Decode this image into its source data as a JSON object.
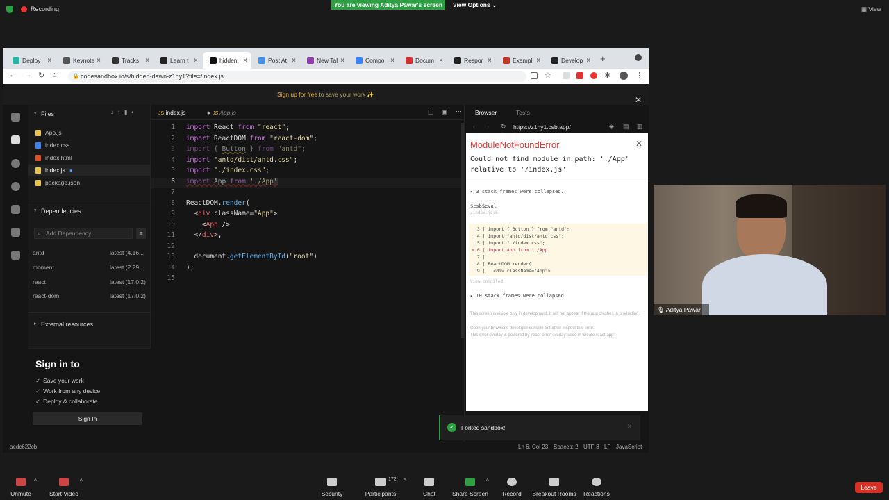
{
  "zoom_top": {
    "recording": "Recording",
    "viewing_banner": "You are viewing Aditya Pawar's screen",
    "view_options": "View Options",
    "view_right": "View"
  },
  "browser": {
    "tabs": [
      {
        "label": "Deploy",
        "color": "#2bb3a3"
      },
      {
        "label": "Keynote",
        "color": "#555555"
      },
      {
        "label": "Tracks",
        "color": "#333333"
      },
      {
        "label": "Learn t",
        "color": "#222222"
      },
      {
        "label": "hidden",
        "color": "#111111"
      },
      {
        "label": "Post At",
        "color": "#4a90e2"
      },
      {
        "label": "New Tal",
        "color": "#8e44ad"
      },
      {
        "label": "Compo",
        "color": "#3b82f6"
      },
      {
        "label": "Docum",
        "color": "#d32f2f"
      },
      {
        "label": "Respor",
        "color": "#222222"
      },
      {
        "label": "Exampl",
        "color": "#c0392b"
      },
      {
        "label": "Develop",
        "color": "#222222"
      }
    ],
    "url": "codesandbox.io/s/hidden-dawn-z1hy1?file=/index.js",
    "signup_link": "Sign up for free",
    "signup_rest": " to save your work ✨"
  },
  "sidebar": {
    "files_header": "Files",
    "files": [
      {
        "name": "App.js",
        "color": "#e8c547"
      },
      {
        "name": "index.css",
        "color": "#3b82f6"
      },
      {
        "name": "index.html",
        "color": "#e44d26"
      },
      {
        "name": "index.js",
        "color": "#e8c547"
      },
      {
        "name": "package.json",
        "color": "#e8c547"
      }
    ],
    "deps_header": "Dependencies",
    "add_dep_placeholder": "Add Dependency",
    "deps": [
      {
        "name": "antd",
        "version": "latest (4.16..."
      },
      {
        "name": "moment",
        "version": "latest (2.29..."
      },
      {
        "name": "react",
        "version": "latest (17.0.2)"
      },
      {
        "name": "react-dom",
        "version": "latest (17.0.2)"
      }
    ],
    "external_header": "External resources",
    "signin_title": "Sign in to",
    "signin_items": [
      "Save your work",
      "Work from any device",
      "Deploy & collaborate"
    ],
    "signin_button": "Sign In"
  },
  "editor": {
    "tab_active": "index.js",
    "tab_other": "App.js",
    "lines": [
      {
        "n": "1"
      },
      {
        "n": "2"
      },
      {
        "n": "3"
      },
      {
        "n": "4"
      },
      {
        "n": "5"
      },
      {
        "n": "6"
      },
      {
        "n": "7"
      },
      {
        "n": "8"
      },
      {
        "n": "9"
      },
      {
        "n": "10"
      },
      {
        "n": "11"
      },
      {
        "n": "12"
      },
      {
        "n": "13"
      },
      {
        "n": "14"
      },
      {
        "n": "15"
      }
    ]
  },
  "preview": {
    "tab_browser": "Browser",
    "tab_tests": "Tests",
    "url": "https://z1hy1.csb.app/",
    "error_title": "ModuleNotFoundError",
    "error_message": "Could not find module in path: './App' relative to '/index.js'",
    "collapsed_1": "▸ 3 stack frames were collapsed.",
    "eval_label": "$csb$eval",
    "eval_path": "/index.js:6",
    "snippet": [
      "  3 | import { Button } from \"antd\";",
      "  4 | import \"antd/dist/antd.css\";",
      "  5 | import \"./index.css\";",
      "> 6 | import App from './App'",
      "  7 |",
      "  8 | ReactDOM.render(",
      "  9 |   <div className=\"App\">"
    ],
    "view_compiled": "View compiled",
    "collapsed_2": "▸ 10 stack frames were collapsed.",
    "footer_1": "This screen is visible only in development. It will not appear if the app crashes in production.",
    "footer_2": "Open your browser's developer console to further inspect this error.",
    "footer_3": "This error overlay is powered by 'react-error-overlay' used in 'create-react-app'."
  },
  "toast": "Forked sandbox!",
  "status": {
    "hash": "aedc622cb",
    "position": "Ln 6, Col 23",
    "spaces": "Spaces: 2",
    "encoding": "UTF-8",
    "eol": "LF",
    "language": "JavaScript"
  },
  "webcam": {
    "name": "Aditya Pawar"
  },
  "zoom_bottom": {
    "unmute": "Unmute",
    "start_video": "Start Video",
    "security": "Security",
    "participants": "Participants",
    "participants_count": "172",
    "chat": "Chat",
    "share_screen": "Share Screen",
    "record": "Record",
    "breakout": "Breakout Rooms",
    "reactions": "Reactions",
    "leave": "Leave"
  }
}
